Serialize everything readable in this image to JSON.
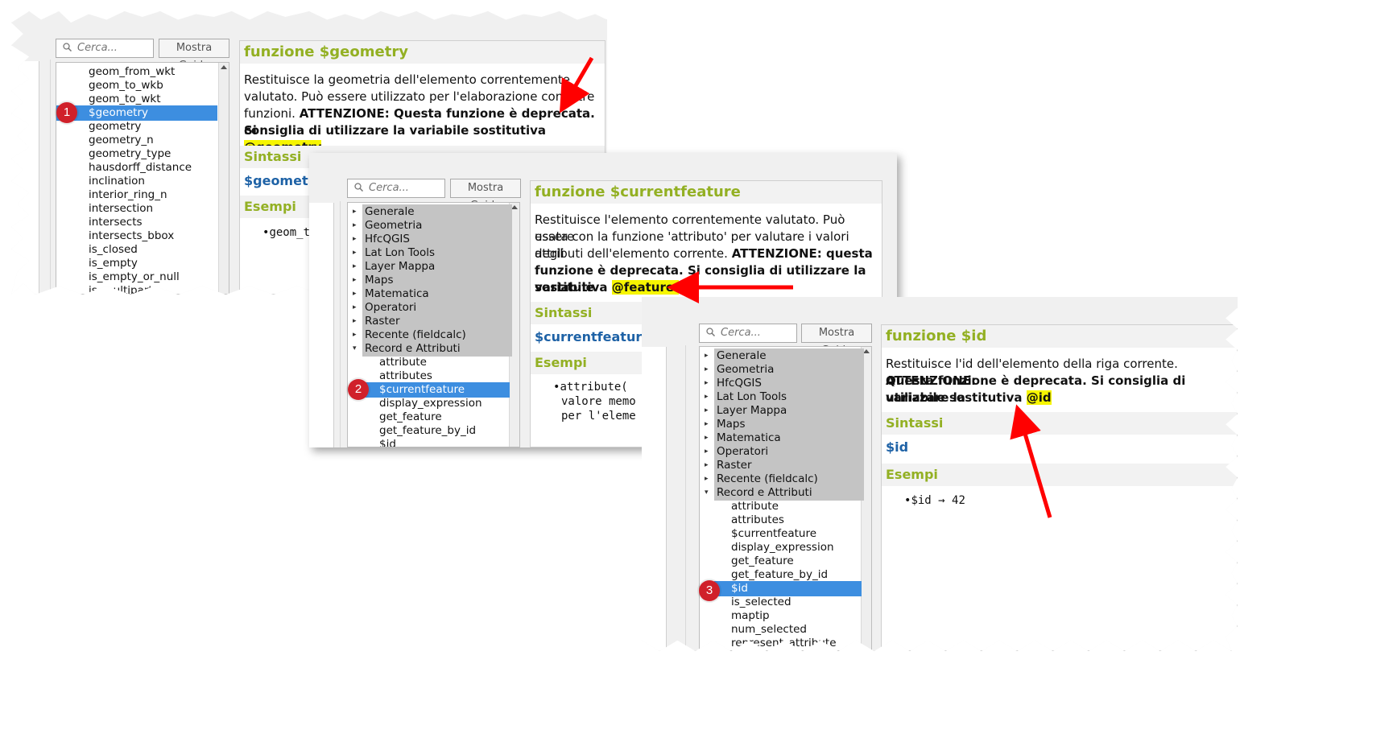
{
  "colors": {
    "accent_green": "#93b023",
    "syntax_blue": "#1e62a6",
    "highlight": "#f6f500",
    "selection": "#3d8ee0",
    "badge": "#d0202a",
    "arrow": "#ff0000"
  },
  "search": {
    "placeholder": "Cerca...",
    "help_button": "Mostra Guida"
  },
  "panel1": {
    "badge": "1",
    "items": [
      "geom_from_wkt",
      "geom_to_wkb",
      "geom_to_wkt",
      "$geometry",
      "geometry",
      "geometry_n",
      "geometry_type",
      "hausdorff_distance",
      "inclination",
      "interior_ring_n",
      "intersection",
      "intersects",
      "intersects_bbox",
      "is_closed",
      "is_empty",
      "is_empty_or_null",
      "is_multipart"
    ],
    "doc": {
      "title": "funzione $geometry",
      "desc_l1": "Restituisce la geometria dell'elemento correntemente",
      "desc_l2": "valutato. Può essere utilizzato per l'elaborazione con altre",
      "desc_l3a": "funzioni. ",
      "desc_l3b": "ATTENZIONE: Questa funzione è deprecata. Si",
      "desc_l4": "consiglia di utilizzare la variabile sostitutiva",
      "desc_hl": "@geometry",
      "syntax_header": "Sintassi",
      "syntax": "$geometry",
      "examples_header": "Esempi",
      "example": "geom_t"
    }
  },
  "panel2": {
    "badge": "2",
    "groups": [
      "Generale",
      "Geometria",
      "HfcQGIS",
      "Lat Lon Tools",
      "Layer Mappa",
      "Maps",
      "Matematica",
      "Operatori",
      "Raster",
      "Recente (fieldcalc)",
      "Record e Attributi"
    ],
    "items": [
      "attribute",
      "attributes",
      "$currentfeature",
      "display_expression",
      "get_feature",
      "get_feature_by_id",
      "$id"
    ],
    "doc": {
      "title": "funzione $currentfeature",
      "desc_l1": "Restituisce l'elemento correntemente valutato. Può essere",
      "desc_l2": "usata con la funzione 'attributo' per valutare i valori degli",
      "desc_l3a": "attributi dell'elemento corrente. ",
      "desc_l3b": "ATTENZIONE: questa",
      "desc_l4": "funzione è deprecata. Si consiglia di utilizzare la variabile",
      "desc_l5": "sostitutiva",
      "desc_hl": "@feature.",
      "syntax_header": "Sintassi",
      "syntax": "$currentfeature",
      "examples_header": "Esempi",
      "ex_l1": "attribute(",
      "ex_l2": "valore memo",
      "ex_l3": "per l'eleme"
    }
  },
  "panel3": {
    "badge": "3",
    "groups": [
      "Generale",
      "Geometria",
      "HfcQGIS",
      "Lat Lon Tools",
      "Layer Mappa",
      "Maps",
      "Matematica",
      "Operatori",
      "Raster",
      "Recente (fieldcalc)",
      "Record e Attributi"
    ],
    "items": [
      "attribute",
      "attributes",
      "$currentfeature",
      "display_expression",
      "get_feature",
      "get_feature_by_id",
      "$id",
      "is_selected",
      "maptip",
      "num_selected",
      "represent_attribute"
    ],
    "doc": {
      "title": "funzione $id",
      "desc_l1a": "Restituisce l'id dell'elemento della riga corrente. ",
      "desc_l1b": "ATTENZIONE:",
      "desc_l2": "Questa funzione è deprecata. Si consiglia di utilizzare la",
      "desc_l3": "variabile sostitutiva",
      "desc_hl": "@id",
      "syntax_header": "Sintassi",
      "syntax": "$id",
      "examples_header": "Esempi",
      "example": "$id → 42"
    }
  }
}
